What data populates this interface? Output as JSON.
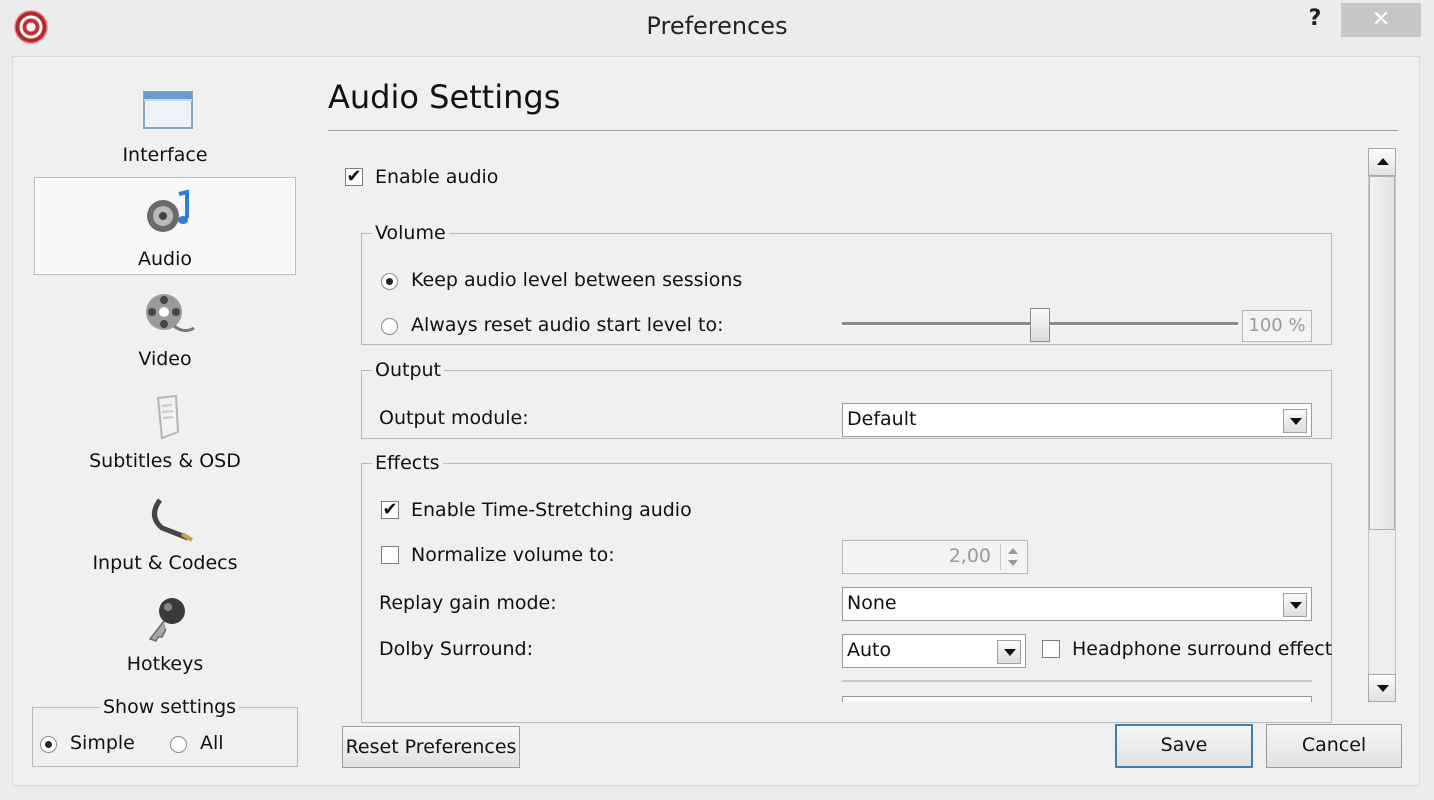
{
  "window": {
    "title": "Preferences",
    "help": "?",
    "close": "✕"
  },
  "sidebar": {
    "items": [
      {
        "label": "Interface",
        "icon": "interface-icon"
      },
      {
        "label": "Audio",
        "icon": "audio-icon",
        "selected": true
      },
      {
        "label": "Video",
        "icon": "video-icon"
      },
      {
        "label": "Subtitles & OSD",
        "icon": "subtitles-icon"
      },
      {
        "label": "Input & Codecs",
        "icon": "input-codecs-icon"
      },
      {
        "label": "Hotkeys",
        "icon": "hotkeys-icon"
      }
    ],
    "show_settings": {
      "title": "Show settings",
      "options": [
        "Simple",
        "All"
      ],
      "selected": "Simple"
    }
  },
  "main": {
    "heading": "Audio Settings",
    "enable_audio": {
      "label": "Enable audio",
      "checked": true
    },
    "volume": {
      "title": "Volume",
      "keep_level": {
        "label": "Keep audio level between sessions",
        "selected": true
      },
      "reset_level": {
        "label": "Always reset audio start level to:",
        "selected": false
      },
      "level_value": "100 %",
      "level_fraction": 0.5
    },
    "output": {
      "title": "Output",
      "module_label": "Output module:",
      "module_value": "Default"
    },
    "effects": {
      "title": "Effects",
      "time_stretching": {
        "label": "Enable Time-Stretching audio",
        "checked": true
      },
      "normalize": {
        "label": "Normalize volume to:",
        "checked": false,
        "value": "2,00"
      },
      "replay_gain": {
        "label": "Replay gain mode:",
        "value": "None"
      },
      "dolby": {
        "label": "Dolby Surround:",
        "value": "Auto"
      },
      "headphone": {
        "label": "Headphone surround effect",
        "checked": false
      }
    }
  },
  "footer": {
    "reset_label": "Reset Preferences",
    "save_label": "Save",
    "cancel_label": "Cancel"
  }
}
